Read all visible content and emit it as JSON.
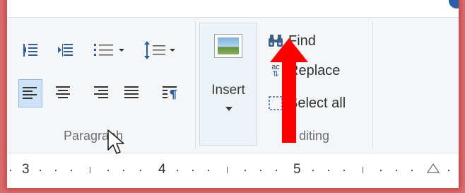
{
  "paragraph": {
    "label": "Paragraph",
    "row1": [
      "Decrease indent",
      "Increase indent",
      "Start a list",
      "Line spacing"
    ],
    "row2": [
      "Align text left",
      "Center",
      "Align text right",
      "Justify",
      "Paragraph"
    ]
  },
  "insert": {
    "label": "Insert"
  },
  "editing": {
    "label": "Editing",
    "label_visible": "diting",
    "find": "Find",
    "replace": "Replace",
    "replace_icon_text": "ac",
    "select_all": "Select all"
  },
  "ruler": {
    "marks": [
      "3",
      "4",
      "5"
    ]
  },
  "colors": {
    "accent": "#2a5fa8",
    "annotation_arrow": "#ff0000",
    "background": "#e06e6e"
  }
}
